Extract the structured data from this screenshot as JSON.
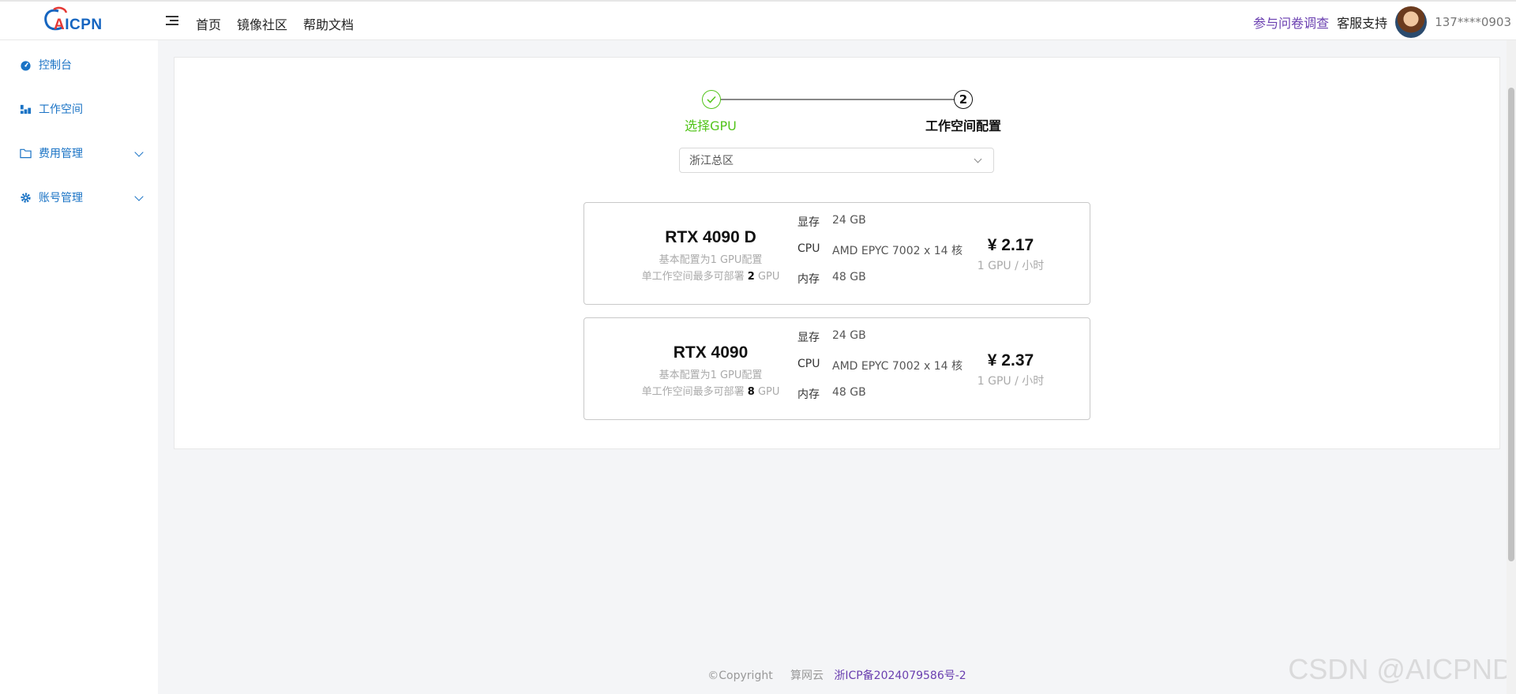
{
  "header": {
    "logo_text_a": "A",
    "logo_text_rest": "ICPN",
    "nav": [
      "首页",
      "镜像社区",
      "帮助文档"
    ],
    "survey_link": "参与问卷调查",
    "support": "客服支持",
    "user": "137****0903"
  },
  "sidebar": {
    "items": [
      {
        "label": "控制台",
        "icon": "dashboard-icon"
      },
      {
        "label": "工作空间",
        "icon": "workspace-icon"
      },
      {
        "label": "费用管理",
        "icon": "folder-icon",
        "expandable": true
      },
      {
        "label": "账号管理",
        "icon": "gear-icon",
        "expandable": true
      }
    ]
  },
  "stepper": {
    "step1": "选择GPU",
    "step2_number": "2",
    "step2": "工作空间配置",
    "step1_status": "done"
  },
  "region": {
    "selected": "浙江总区"
  },
  "gpus": [
    {
      "name": "RTX 4090 D",
      "sub1": "基本配置为1 GPU配置",
      "sub2_prefix": "单工作空间最多可部署 ",
      "max_gpu": "2",
      "sub2_suffix": " GPU",
      "vram_label": "显存",
      "vram": "24 GB",
      "cpu_label": "CPU",
      "cpu": "AMD EPYC 7002 x 14 核",
      "mem_label": "内存",
      "mem": "48 GB",
      "price": "¥ 2.17",
      "unit": "1 GPU / 小时"
    },
    {
      "name": "RTX 4090",
      "sub1": "基本配置为1 GPU配置",
      "sub2_prefix": "单工作空间最多可部署 ",
      "max_gpu": "8",
      "sub2_suffix": " GPU",
      "vram_label": "显存",
      "vram": "24 GB",
      "cpu_label": "CPU",
      "cpu": "AMD EPYC 7002 x 14 核",
      "mem_label": "内存",
      "mem": "48 GB",
      "price": "¥ 2.37",
      "unit": "1 GPU / 小时"
    }
  ],
  "footer": {
    "copyright": "©Copyright",
    "brand": "算网云",
    "icp": "浙ICP备2024079586号-2"
  },
  "watermark": "CSDN @AICPND",
  "colors": {
    "accent_blue": "#1a73c5",
    "success_green": "#52c41a",
    "link_purple": "#6a3fb0"
  }
}
